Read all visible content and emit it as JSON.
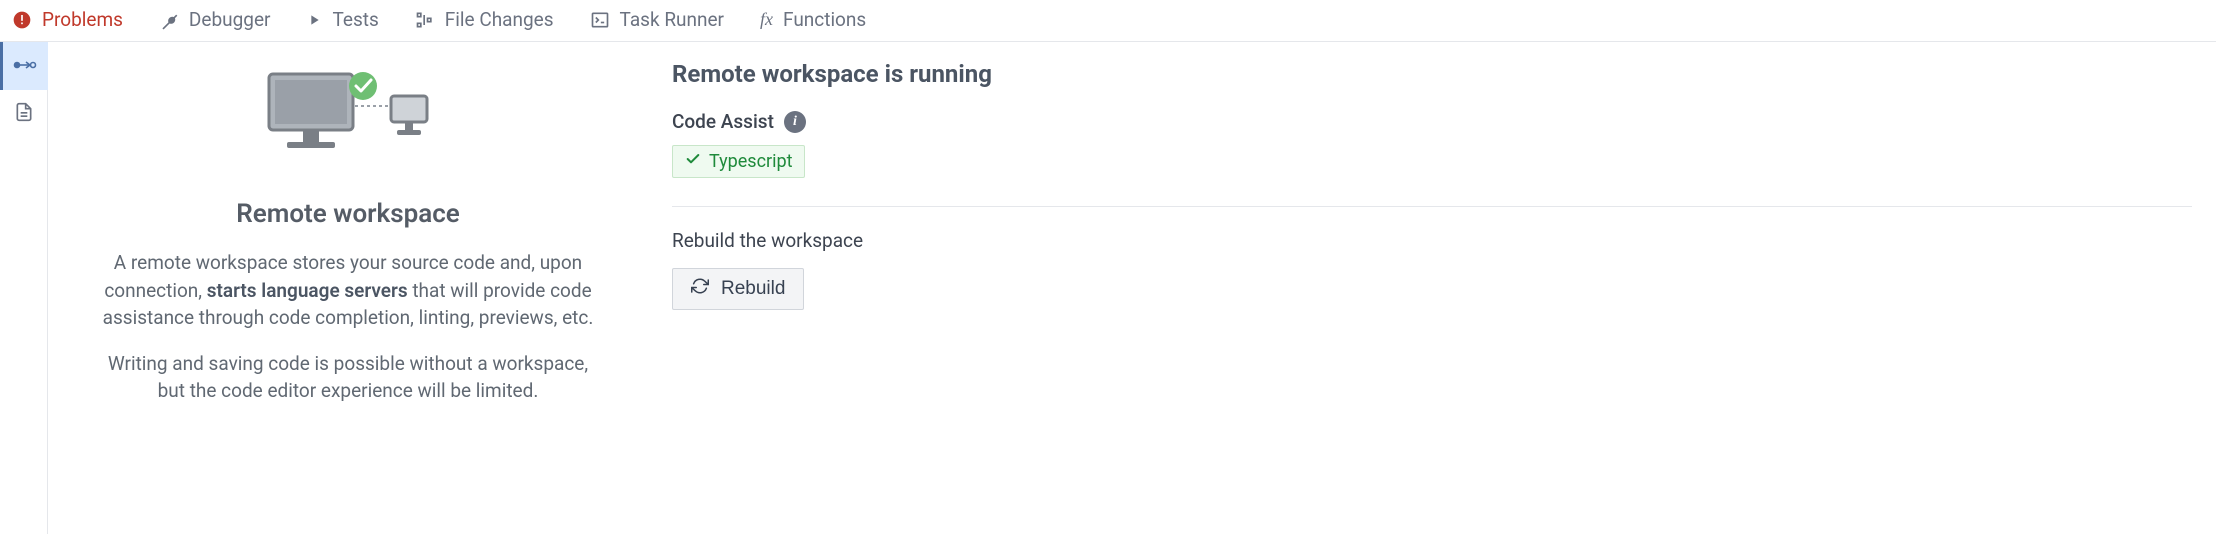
{
  "tabs": [
    {
      "id": "problems",
      "label": "Problems"
    },
    {
      "id": "debugger",
      "label": "Debugger"
    },
    {
      "id": "tests",
      "label": "Tests"
    },
    {
      "id": "file-changes",
      "label": "File Changes"
    },
    {
      "id": "task-runner",
      "label": "Task Runner"
    },
    {
      "id": "functions",
      "label": "Functions"
    }
  ],
  "explainer": {
    "title": "Remote workspace",
    "p1_pre": "A remote workspace stores your source code and, upon connection, ",
    "p1_bold": "starts language servers",
    "p1_post": " that will provide code assistance through code completion, linting, previews, etc.",
    "p2": "Writing and saving code is possible without a workspace, but the code editor experience will be limited."
  },
  "status": {
    "title": "Remote workspace is running",
    "code_assist_label": "Code Assist",
    "info_glyph": "i",
    "typescript_chip": "Typescript",
    "rebuild_heading": "Rebuild the workspace",
    "rebuild_button": "Rebuild"
  }
}
